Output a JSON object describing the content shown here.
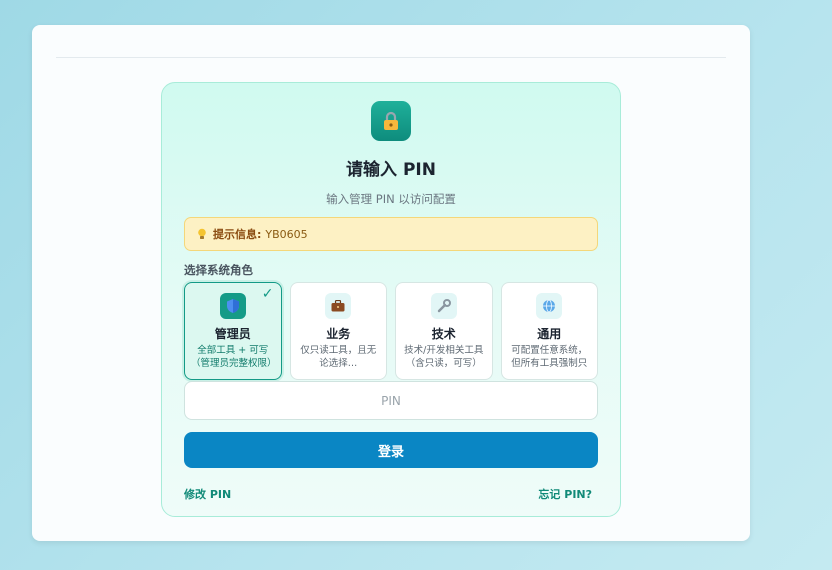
{
  "login": {
    "title": "请输入 PIN",
    "subtitle": "输入管理 PIN 以访问配置",
    "hint_label": "提示信息:",
    "hint_value": "YB0605",
    "role_section_label": "选择系统角色",
    "roles": [
      {
        "name": "管理员",
        "desc": "全部工具 + 可写（管理员完整权限）",
        "icon": "shield-icon",
        "selected": true
      },
      {
        "name": "业务",
        "desc": "仅只读工具，且无论选择…",
        "icon": "briefcase-icon",
        "selected": false
      },
      {
        "name": "技术",
        "desc": "技术/开发相关工具（含只读，可写）",
        "icon": "wrench-icon",
        "selected": false
      },
      {
        "name": "通用",
        "desc": "可配置任意系统，但所有工具强制只读",
        "icon": "globe-icon",
        "selected": false
      }
    ],
    "check_mark": "✓",
    "pin_placeholder": "PIN",
    "pin_value": "",
    "submit_label": "登录",
    "change_pin_label": "修改 PIN",
    "forgot_pin_label": "忘记 PIN?"
  },
  "colors": {
    "accent": "#139a86",
    "button": "#0a86c4",
    "hint_bg": "#fdf1c4"
  }
}
